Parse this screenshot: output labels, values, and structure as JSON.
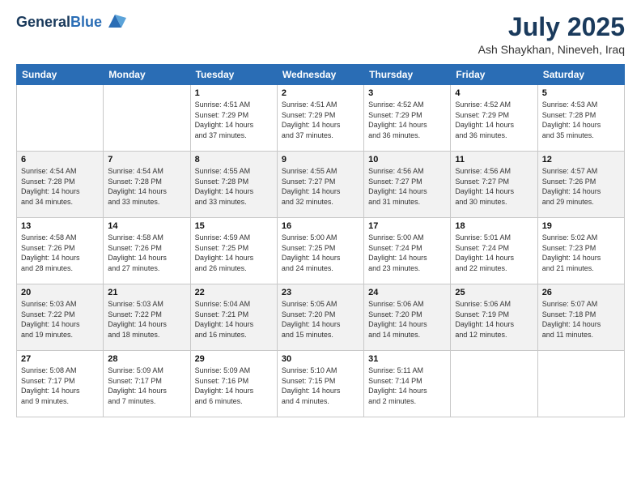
{
  "header": {
    "logo_line1": "General",
    "logo_line2": "Blue",
    "month_title": "July 2025",
    "location": "Ash Shaykhan, Nineveh, Iraq"
  },
  "days_of_week": [
    "Sunday",
    "Monday",
    "Tuesday",
    "Wednesday",
    "Thursday",
    "Friday",
    "Saturday"
  ],
  "weeks": [
    {
      "alt": false,
      "days": [
        {
          "num": "",
          "info": ""
        },
        {
          "num": "",
          "info": ""
        },
        {
          "num": "1",
          "info": "Sunrise: 4:51 AM\nSunset: 7:29 PM\nDaylight: 14 hours\nand 37 minutes."
        },
        {
          "num": "2",
          "info": "Sunrise: 4:51 AM\nSunset: 7:29 PM\nDaylight: 14 hours\nand 37 minutes."
        },
        {
          "num": "3",
          "info": "Sunrise: 4:52 AM\nSunset: 7:29 PM\nDaylight: 14 hours\nand 36 minutes."
        },
        {
          "num": "4",
          "info": "Sunrise: 4:52 AM\nSunset: 7:29 PM\nDaylight: 14 hours\nand 36 minutes."
        },
        {
          "num": "5",
          "info": "Sunrise: 4:53 AM\nSunset: 7:28 PM\nDaylight: 14 hours\nand 35 minutes."
        }
      ]
    },
    {
      "alt": true,
      "days": [
        {
          "num": "6",
          "info": "Sunrise: 4:54 AM\nSunset: 7:28 PM\nDaylight: 14 hours\nand 34 minutes."
        },
        {
          "num": "7",
          "info": "Sunrise: 4:54 AM\nSunset: 7:28 PM\nDaylight: 14 hours\nand 33 minutes."
        },
        {
          "num": "8",
          "info": "Sunrise: 4:55 AM\nSunset: 7:28 PM\nDaylight: 14 hours\nand 33 minutes."
        },
        {
          "num": "9",
          "info": "Sunrise: 4:55 AM\nSunset: 7:27 PM\nDaylight: 14 hours\nand 32 minutes."
        },
        {
          "num": "10",
          "info": "Sunrise: 4:56 AM\nSunset: 7:27 PM\nDaylight: 14 hours\nand 31 minutes."
        },
        {
          "num": "11",
          "info": "Sunrise: 4:56 AM\nSunset: 7:27 PM\nDaylight: 14 hours\nand 30 minutes."
        },
        {
          "num": "12",
          "info": "Sunrise: 4:57 AM\nSunset: 7:26 PM\nDaylight: 14 hours\nand 29 minutes."
        }
      ]
    },
    {
      "alt": false,
      "days": [
        {
          "num": "13",
          "info": "Sunrise: 4:58 AM\nSunset: 7:26 PM\nDaylight: 14 hours\nand 28 minutes."
        },
        {
          "num": "14",
          "info": "Sunrise: 4:58 AM\nSunset: 7:26 PM\nDaylight: 14 hours\nand 27 minutes."
        },
        {
          "num": "15",
          "info": "Sunrise: 4:59 AM\nSunset: 7:25 PM\nDaylight: 14 hours\nand 26 minutes."
        },
        {
          "num": "16",
          "info": "Sunrise: 5:00 AM\nSunset: 7:25 PM\nDaylight: 14 hours\nand 24 minutes."
        },
        {
          "num": "17",
          "info": "Sunrise: 5:00 AM\nSunset: 7:24 PM\nDaylight: 14 hours\nand 23 minutes."
        },
        {
          "num": "18",
          "info": "Sunrise: 5:01 AM\nSunset: 7:24 PM\nDaylight: 14 hours\nand 22 minutes."
        },
        {
          "num": "19",
          "info": "Sunrise: 5:02 AM\nSunset: 7:23 PM\nDaylight: 14 hours\nand 21 minutes."
        }
      ]
    },
    {
      "alt": true,
      "days": [
        {
          "num": "20",
          "info": "Sunrise: 5:03 AM\nSunset: 7:22 PM\nDaylight: 14 hours\nand 19 minutes."
        },
        {
          "num": "21",
          "info": "Sunrise: 5:03 AM\nSunset: 7:22 PM\nDaylight: 14 hours\nand 18 minutes."
        },
        {
          "num": "22",
          "info": "Sunrise: 5:04 AM\nSunset: 7:21 PM\nDaylight: 14 hours\nand 16 minutes."
        },
        {
          "num": "23",
          "info": "Sunrise: 5:05 AM\nSunset: 7:20 PM\nDaylight: 14 hours\nand 15 minutes."
        },
        {
          "num": "24",
          "info": "Sunrise: 5:06 AM\nSunset: 7:20 PM\nDaylight: 14 hours\nand 14 minutes."
        },
        {
          "num": "25",
          "info": "Sunrise: 5:06 AM\nSunset: 7:19 PM\nDaylight: 14 hours\nand 12 minutes."
        },
        {
          "num": "26",
          "info": "Sunrise: 5:07 AM\nSunset: 7:18 PM\nDaylight: 14 hours\nand 11 minutes."
        }
      ]
    },
    {
      "alt": false,
      "days": [
        {
          "num": "27",
          "info": "Sunrise: 5:08 AM\nSunset: 7:17 PM\nDaylight: 14 hours\nand 9 minutes."
        },
        {
          "num": "28",
          "info": "Sunrise: 5:09 AM\nSunset: 7:17 PM\nDaylight: 14 hours\nand 7 minutes."
        },
        {
          "num": "29",
          "info": "Sunrise: 5:09 AM\nSunset: 7:16 PM\nDaylight: 14 hours\nand 6 minutes."
        },
        {
          "num": "30",
          "info": "Sunrise: 5:10 AM\nSunset: 7:15 PM\nDaylight: 14 hours\nand 4 minutes."
        },
        {
          "num": "31",
          "info": "Sunrise: 5:11 AM\nSunset: 7:14 PM\nDaylight: 14 hours\nand 2 minutes."
        },
        {
          "num": "",
          "info": ""
        },
        {
          "num": "",
          "info": ""
        }
      ]
    }
  ]
}
